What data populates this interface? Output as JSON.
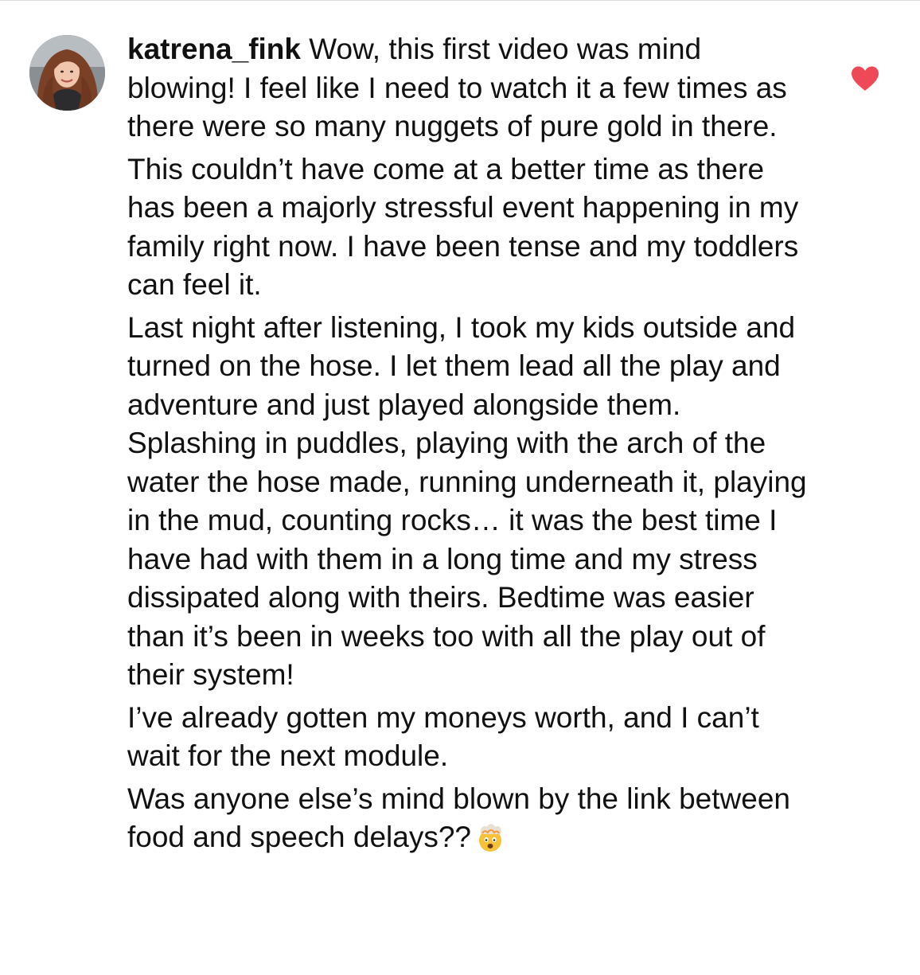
{
  "comment": {
    "username": "katrena_fink",
    "paragraphs": [
      "Wow, this first video was mind blowing! I feel like I need to watch it a few times as there were so many nuggets of pure gold in there.",
      "This couldn’t have come at a better time as there has been a majorly stressful event happening in my family right now. I have been tense and my toddlers can feel it.",
      "Last night after listening, I took my kids outside and turned on the hose. I let them lead all the play and adventure and just played alongside them. Splashing in puddles, playing with the arch of the water the hose made, running underneath it, playing in the mud, counting rocks… it was the best time I have had with them in a long time and my stress dissipated along with theirs. Bedtime was easier than it’s been in weeks too with all the play out of their system!",
      "I’ve already gotten my moneys worth, and I can’t wait for the next module.",
      "Was anyone else’s mind blown by the link between food and speech delays??"
    ],
    "trailing_emoji": "exploding-head-emoji"
  },
  "like": {
    "icon": "heart-icon",
    "liked": true,
    "color": "#ed4956"
  }
}
